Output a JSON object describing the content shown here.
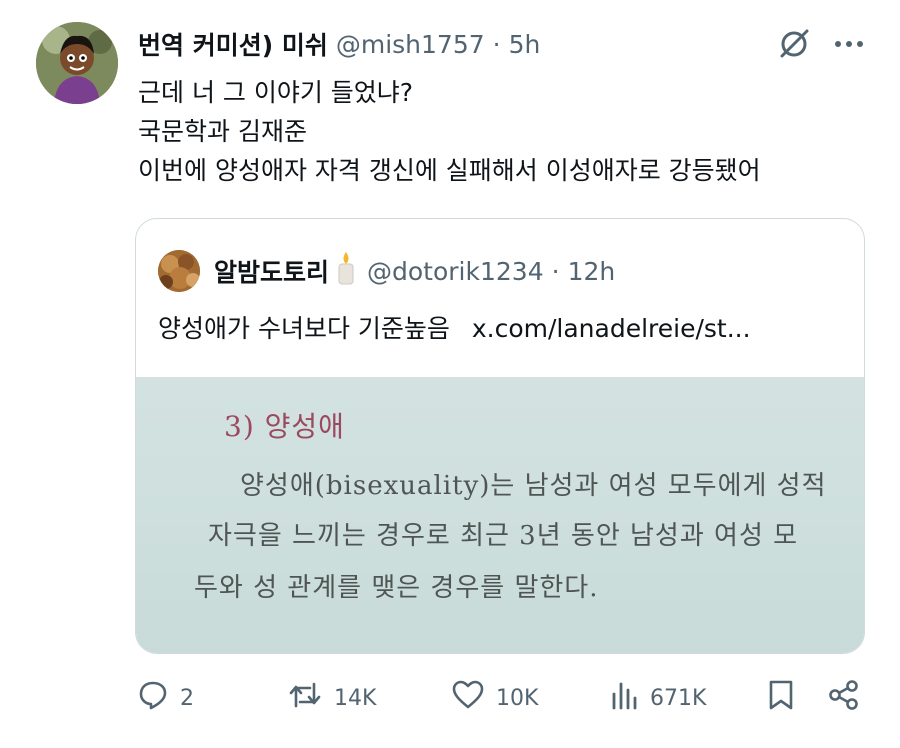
{
  "tweet": {
    "author_name": "번역 커미션) 미쉬",
    "handle": "@mish1757",
    "separator": "·",
    "time": "5h",
    "lines": [
      "근데 너 그 이야기 들었냐?",
      "국문학과 김재준",
      "이번에 양성애자 자격 갱신에 실패해서 이성애자로 강등됐어"
    ]
  },
  "quote": {
    "author_name": "알밤도토리",
    "handle": "@dotorik1234",
    "separator": "·",
    "time": "12h",
    "text": "양성애가 수녀보다 기준높음",
    "link": "x.com/lanadelreie/st...",
    "image": {
      "heading": "3) 양성애",
      "lines": [
        "양성애(bisexuality)는 남성과 여성 모두에게 성적",
        "자극을 느끼는 경우로 최근 3년 동안 남성과 여성 모",
        "두와 성 관계를 맺은 경우를 말한다."
      ]
    }
  },
  "actions": {
    "replies": "2",
    "reposts": "14K",
    "likes": "10K",
    "views": "671K"
  },
  "icons": {
    "grok": "grok-icon",
    "more": "more-icon",
    "reply": "reply-icon",
    "repost": "repost-icon",
    "like": "like-icon",
    "views": "views-icon",
    "bookmark": "bookmark-icon",
    "share": "share-icon"
  },
  "colors": {
    "text": "#0f1419",
    "secondary": "#536471",
    "border": "#cfd9de",
    "book_heading": "#9a4a5e"
  }
}
